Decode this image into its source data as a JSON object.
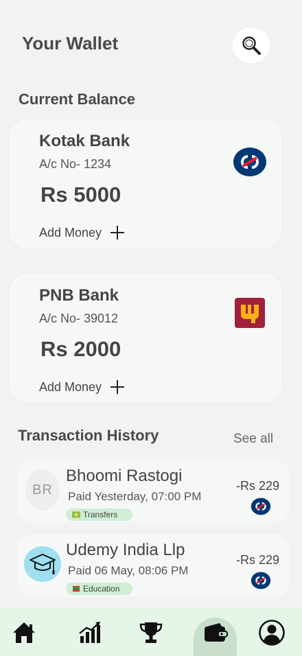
{
  "header": {
    "title": "Your Wallet",
    "search_icon": "search-icon"
  },
  "balance_section": {
    "title": "Current Balance"
  },
  "accounts": [
    {
      "bank": "Kotak Bank",
      "acno": "A/c No- 1234",
      "balance": "Rs 5000",
      "add_label": "Add Money",
      "logo": "kotak-logo-icon",
      "logo_color": "#003874",
      "accent": "#ed1c24"
    },
    {
      "bank": "PNB Bank",
      "acno": "A/c No- 39012",
      "balance": "Rs 2000",
      "add_label": "Add Money",
      "logo": "pnb-logo-icon",
      "logo_color": "#a2213a",
      "accent": "#f9b21a"
    }
  ],
  "history": {
    "title": "Transaction History",
    "see_all": "See all",
    "items": [
      {
        "name": "Bhoomi Rastogi",
        "initials": "BR",
        "sub": "Paid Yesterday, 07:00 PM",
        "tag": "Transfers",
        "tag_icon": "money-icon",
        "amount": "-Rs 229",
        "bank_icon": "kotak-logo-icon"
      },
      {
        "name": "Udemy India Llp",
        "sub": "Paid 06 May, 08:06 PM",
        "tag": "Education",
        "tag_icon": "books-icon",
        "amount": "-Rs 229",
        "bank_icon": "kotak-logo-icon",
        "avatar_icon": "graduation-cap-icon"
      }
    ]
  },
  "nav": [
    {
      "name": "home",
      "icon": "home-icon"
    },
    {
      "name": "stats",
      "icon": "chart-icon"
    },
    {
      "name": "rewards",
      "icon": "trophy-icon"
    },
    {
      "name": "wallet",
      "icon": "wallet-icon",
      "active": true
    },
    {
      "name": "profile",
      "icon": "profile-icon"
    }
  ],
  "colors": {
    "background": "#f2f2f2",
    "card": "#f6f7f7",
    "nav_bg": "#e5f5e7",
    "tag_bg": "#cfeed4"
  }
}
